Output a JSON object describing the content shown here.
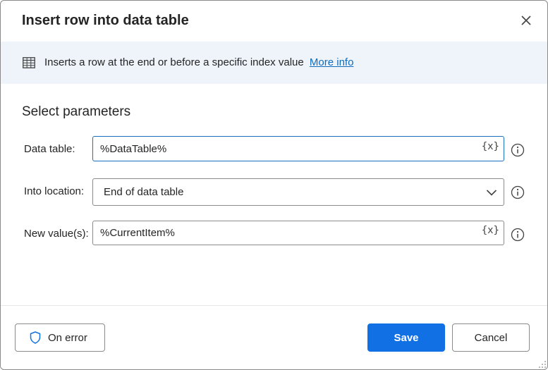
{
  "dialog": {
    "title": "Insert row into data table",
    "close_icon": "close-icon"
  },
  "info": {
    "icon": "table-icon",
    "text": "Inserts a row at the end or before a specific index value",
    "link": "More info"
  },
  "section_title": "Select parameters",
  "fields": {
    "data_table": {
      "label": "Data table:",
      "value": "%DataTable%",
      "var_button": "{x}"
    },
    "into_location": {
      "label": "Into location:",
      "value": "End of data table"
    },
    "new_values": {
      "label": "New value(s):",
      "value": "%CurrentItem%",
      "var_button": "{x}"
    }
  },
  "footer": {
    "on_error": "On error",
    "save": "Save",
    "cancel": "Cancel"
  },
  "colors": {
    "accent": "#1170e3",
    "info_bar": "#eff4fb",
    "link": "#0f6cbd"
  }
}
